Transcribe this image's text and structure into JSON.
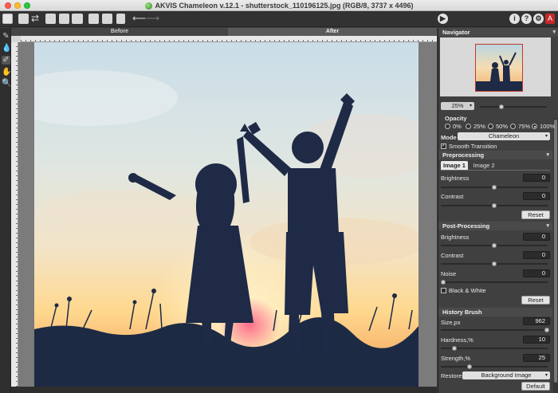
{
  "window": {
    "title": "AKVIS Chameleon v.12.1 - shutterstock_110196125.jpg (RGB/8, 3737 x 4496)"
  },
  "toolbar": {
    "buttons": [
      "image-mode-icon",
      "open-icon",
      "swap-icon",
      "save-icon",
      "save-as-icon",
      "print-icon",
      "share-icon",
      "batch-icon",
      "layer-icon",
      "undo-icon",
      "redo-icon",
      "run-icon",
      "info-icon",
      "help-icon",
      "settings-icon",
      "akvis-icon"
    ],
    "info_label": "i",
    "help_label": "?",
    "akvis_label": "A"
  },
  "canvas": {
    "tab_before": "Before",
    "tab_after": "After"
  },
  "navigator": {
    "title": "Navigator",
    "zoom_value": "25%",
    "zoom_fraction": 0.42
  },
  "panel": {
    "opacity": {
      "label": "Opacity",
      "options": [
        "0%",
        "25%",
        "50%",
        "75%",
        "100%"
      ],
      "selected": "100%"
    },
    "mode": {
      "label": "Mode",
      "value": "Chameleon"
    },
    "smooth_transition": {
      "label": "Smooth Transition",
      "checked": true
    },
    "preprocessing": {
      "title": "Preprocessing",
      "tabs": [
        "Image 1",
        "Image 2"
      ],
      "active_tab": "Image 1",
      "brightness": {
        "label": "Brightness",
        "value": "0",
        "fraction": 0.5
      },
      "contrast": {
        "label": "Contrast",
        "value": "0",
        "fraction": 0.5
      },
      "reset": "Reset"
    },
    "postprocessing": {
      "title": "Post-Processing",
      "brightness": {
        "label": "Brightness",
        "value": "0",
        "fraction": 0.5
      },
      "contrast": {
        "label": "Contrast",
        "value": "0",
        "fraction": 0.5
      },
      "noise": {
        "label": "Noise",
        "value": "0",
        "fraction": 0.0
      },
      "black_white": {
        "label": "Black & White",
        "checked": false
      },
      "reset": "Reset"
    },
    "history_brush": {
      "title": "History Brush",
      "size": {
        "label": "Size,px",
        "value": "962",
        "fraction": 1.0
      },
      "hardness": {
        "label": "Hardness,%",
        "value": "10",
        "fraction": 0.1
      },
      "strength": {
        "label": "Strength,%",
        "value": "25",
        "fraction": 0.25
      },
      "restore_label": "Restore",
      "restore_value": "Background Image",
      "default": "Default"
    }
  },
  "colors": {
    "panel_bg": "#404040",
    "akvis_red": "#c62828",
    "sky_top": "#c9dde8",
    "sunset": "#ffd27a"
  }
}
